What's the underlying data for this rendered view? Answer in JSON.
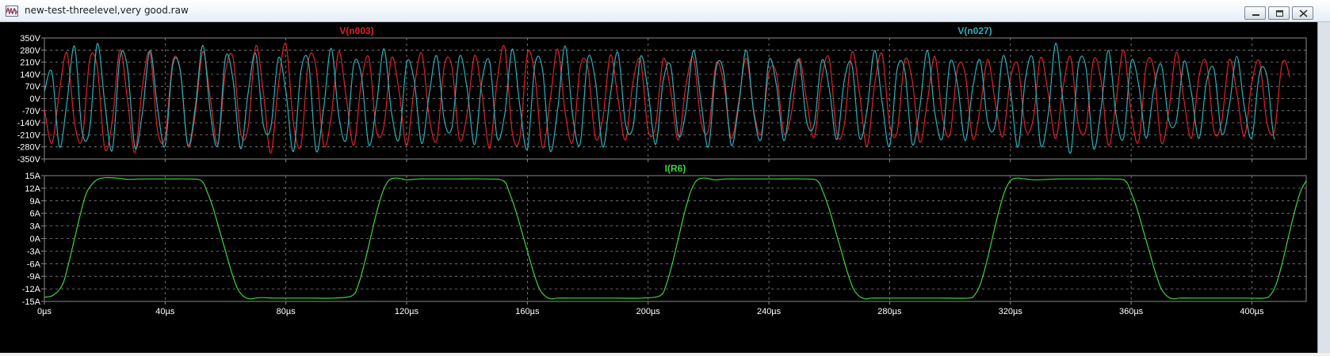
{
  "window": {
    "title": "new-test-threelevel,very good.raw",
    "icon": "waveform-icon",
    "buttons": [
      "minimize-icon",
      "restore-icon",
      "close-icon"
    ]
  },
  "colors": {
    "background": "#000000",
    "grid": "#8a8a8a",
    "axis_text": "#ffffff",
    "v_n003": "#e0222a",
    "v_n027": "#2bb0b8",
    "i_r6": "#3fd23f"
  },
  "chart_data": [
    {
      "type": "line",
      "title": "",
      "xlabel": "",
      "ylabel": "",
      "xlim": [
        0,
        418
      ],
      "ylim": [
        -350,
        350
      ],
      "x_ticks": [
        "0µs",
        "40µs",
        "80µs",
        "120µs",
        "160µs",
        "200µs",
        "240µs",
        "280µs",
        "320µs",
        "360µs",
        "400µs"
      ],
      "y_ticks": [
        "350V",
        "280V",
        "210V",
        "140V",
        "70V",
        "0V",
        "-70V",
        "-140V",
        "-210V",
        "-280V",
        "-350V"
      ],
      "grid": true,
      "series": [
        {
          "name": "V(n003)",
          "color": "#e0222a",
          "description_values": {
            "x": [
              0,
              2.5,
              5,
              7.5,
              10,
              12.5,
              15,
              17.5,
              20,
              22.5,
              25,
              27.5,
              30,
              32.5,
              35,
              37.5,
              40,
              42.5,
              45,
              47.5,
              50,
              52.5,
              55,
              57.5,
              60,
              62.5,
              65,
              67.5,
              70,
              72.5,
              75,
              77.5,
              80,
              82.5,
              85,
              87.5,
              90,
              92.5,
              95,
              97.5,
              100,
              102.5,
              105,
              107.5,
              110,
              112.5,
              115,
              117.5,
              120,
              122.5,
              125,
              127.5,
              130,
              132.5,
              135,
              137.5,
              140,
              142.5,
              145,
              147.5,
              150,
              152.5,
              155,
              157.5,
              160,
              162.5,
              165,
              167.5,
              170,
              172.5,
              175,
              177.5,
              180,
              182.5,
              185,
              187.5,
              190,
              192.5,
              195,
              197.5,
              200,
              202.5,
              205,
              207.5,
              210,
              212.5,
              215,
              217.5,
              220,
              222.5,
              225,
              227.5,
              230,
              232.5,
              235,
              237.5,
              240,
              242.5,
              245,
              247.5,
              250,
              252.5,
              255,
              257.5,
              260,
              262.5,
              265,
              267.5,
              270,
              272.5,
              275,
              277.5,
              280,
              282.5,
              285,
              287.5,
              290,
              292.5,
              295,
              297.5,
              300,
              302.5,
              305,
              307.5,
              310,
              312.5,
              315,
              317.5,
              320,
              322.5,
              325,
              327.5,
              330,
              332.5,
              335,
              337.5,
              340,
              342.5,
              345,
              347.5,
              350,
              352.5,
              355,
              357.5,
              360,
              362.5,
              365,
              367.5,
              370,
              372.5,
              375,
              377.5,
              380,
              382.5,
              385,
              387.5,
              390,
              392.5,
              395,
              397.5,
              400,
              402.5,
              405,
              407.5,
              410,
              412.5,
              415,
              417.5
            ],
            "y": [
              -60,
              -259,
              42,
              264,
              -142,
              -236,
              223,
              182,
              -290,
              -129,
              280,
              -3,
              -312,
              73,
              263,
              -185,
              -221,
              212,
              160,
              -275,
              -89,
              271,
              -3,
              -261,
              158,
              236,
              -199,
              -166,
              303,
              42,
              -315,
              76,
              316,
              -141,
              -270,
              223,
              179,
              -270,
              -108,
              271,
              5,
              -270,
              96,
              235,
              -189,
              -156,
              236,
              42,
              -273,
              62,
              261,
              -109,
              -240,
              191,
              183,
              -235,
              -93,
              249,
              22,
              -288,
              105,
              296,
              -196,
              -226,
              260,
              132,
              -284,
              -20,
              287,
              -80,
              -251,
              181,
              183,
              -225,
              -114,
              251,
              4,
              -240,
              98,
              220,
              -185,
              -154,
              229,
              39,
              -240,
              74,
              236,
              -131,
              -179,
              199,
              90,
              -229,
              -21,
              234,
              -73,
              -203,
              150,
              144,
              -201,
              -80,
              232,
              -10,
              -225,
              118,
              232,
              -202,
              -150,
              269,
              33,
              -277,
              77,
              257,
              -150,
              -193,
              221,
              102,
              -253,
              -16,
              243,
              -106,
              -208,
              175,
              146,
              -231,
              -56,
              226,
              -25,
              -220,
              114,
              194,
              -176,
              -124,
              237,
              33,
              -231,
              70,
              239,
              -145,
              -177,
              222,
              110,
              -272,
              -15,
              281,
              -83,
              -250,
              192,
              171,
              -255,
              -70,
              268,
              -10,
              -228,
              131,
              204,
              -193,
              -131,
              224,
              35,
              -220,
              94,
              213,
              -141,
              -185,
              201,
              123,
              -208
            ]
          }
        },
        {
          "name": "V(n027)",
          "color": "#2bb0b8",
          "description_values": {
            "x": [
              0,
              2.5,
              5,
              7.5,
              10,
              12.5,
              15,
              17.5,
              20,
              22.5,
              25,
              27.5,
              30,
              32.5,
              35,
              37.5,
              40,
              42.5,
              45,
              47.5,
              50,
              52.5,
              55,
              57.5,
              60,
              62.5,
              65,
              67.5,
              70,
              72.5,
              75,
              77.5,
              80,
              82.5,
              85,
              87.5,
              90,
              92.5,
              95,
              97.5,
              100,
              102.5,
              105,
              107.5,
              110,
              112.5,
              115,
              117.5,
              120,
              122.5,
              125,
              127.5,
              130,
              132.5,
              135,
              137.5,
              140,
              142.5,
              145,
              147.5,
              150,
              152.5,
              155,
              157.5,
              160,
              162.5,
              165,
              167.5,
              170,
              172.5,
              175,
              177.5,
              180,
              182.5,
              185,
              187.5,
              190,
              192.5,
              195,
              197.5,
              200,
              202.5,
              205,
              207.5,
              210,
              212.5,
              215,
              217.5,
              220,
              222.5,
              225,
              227.5,
              230,
              232.5,
              235,
              237.5,
              240,
              242.5,
              245,
              247.5,
              250,
              252.5,
              255,
              257.5,
              260,
              262.5,
              265,
              267.5,
              270,
              272.5,
              275,
              277.5,
              280,
              282.5,
              285,
              287.5,
              290,
              292.5,
              295,
              297.5,
              300,
              302.5,
              305,
              307.5,
              310,
              312.5,
              315,
              317.5,
              320,
              322.5,
              325,
              327.5,
              330,
              332.5,
              335,
              337.5,
              340,
              342.5,
              345,
              347.5,
              350,
              352.5,
              355,
              357.5,
              360,
              362.5,
              365,
              367.5,
              370,
              372.5,
              375,
              377.5,
              380,
              382.5,
              385,
              387.5,
              390,
              392.5,
              395,
              397.5,
              400,
              402.5,
              405,
              407.5,
              410,
              412.5,
              415,
              417.5
            ],
            "y": [
              40,
              153,
              -280,
              -16,
              302,
              -193,
              -178,
              317,
              -25,
              -299,
              232,
              181,
              -285,
              -77,
              278,
              -56,
              -274,
              194,
              163,
              -268,
              -50,
              307,
              -85,
              -267,
              239,
              108,
              -290,
              34,
              260,
              -149,
              -169,
              234,
              42,
              -306,
              158,
              209,
              -303,
              -59,
              290,
              -98,
              -235,
              199,
              133,
              -270,
              -39,
              287,
              -81,
              -234,
              205,
              103,
              -260,
              27,
              246,
              -128,
              -166,
              243,
              61,
              -267,
              109,
              212,
              -228,
              -90,
              286,
              -41,
              -292,
              196,
              171,
              -302,
              -67,
              304,
              -101,
              -261,
              232,
              106,
              -281,
              22,
              267,
              -147,
              -164,
              243,
              41,
              -265,
              102,
              187,
              -212,
              -74,
              278,
              -16,
              -279,
              173,
              155,
              -269,
              -41,
              281,
              -85,
              -231,
              219,
              77,
              -244,
              50,
              222,
              -133,
              -150,
              219,
              58,
              -238,
              108,
              196,
              -227,
              -70,
              278,
              -22,
              -276,
              169,
              162,
              -265,
              -49,
              278,
              -84,
              -227,
              208,
              80,
              -244,
              57,
              220,
              -141,
              -152,
              244,
              51,
              -282,
              117,
              226,
              -267,
              -95,
              319,
              -26,
              -314,
              188,
              181,
              -287,
              -62,
              279,
              -96,
              -228,
              213,
              80,
              -229,
              53,
              196,
              -130,
              -126,
              214,
              29,
              -231,
              99,
              165,
              -204,
              -44,
              244,
              -48,
              -226,
              146,
              129,
              -237,
              -22
            ]
          }
        }
      ]
    },
    {
      "type": "line",
      "title": "",
      "xlabel": "",
      "ylabel": "",
      "xlim": [
        0,
        418
      ],
      "ylim": [
        -15,
        15
      ],
      "x_ticks": [
        "0µs",
        "40µs",
        "80µs",
        "120µs",
        "160µs",
        "200µs",
        "240µs",
        "280µs",
        "320µs",
        "360µs",
        "400µs"
      ],
      "y_ticks": [
        "15A",
        "12A",
        "9A",
        "6A",
        "3A",
        "0A",
        "-3A",
        "-6A",
        "-9A",
        "-12A",
        "-15A"
      ],
      "grid": true,
      "series": [
        {
          "name": "I(R6)",
          "color": "#3fd23f",
          "description_values": {
            "x": [
              0,
              3,
              6,
              8,
              10,
              12,
              14,
              17,
              20,
              24,
              28,
              32,
              40,
              48,
              52,
              54,
              56,
              58,
              60,
              62,
              64,
              66,
              68,
              70,
              72,
              76,
              80,
              88,
              96,
              102,
              104,
              106,
              108,
              110,
              112,
              114,
              116,
              118,
              120,
              124,
              128,
              136,
              146,
              152,
              154,
              156,
              158,
              160,
              162,
              164,
              166,
              168,
              170,
              174,
              180,
              188,
              198,
              204,
              206,
              208,
              210,
              212,
              214,
              216,
              218,
              220,
              222,
              226,
              232,
              242,
              252,
              256,
              258,
              260,
              262,
              264,
              266,
              268,
              270,
              272,
              274,
              278,
              286,
              296,
              306,
              308,
              310,
              312,
              314,
              316,
              318,
              320,
              322,
              324,
              328,
              336,
              346,
              354,
              358,
              360,
              362,
              364,
              366,
              368,
              370,
              372,
              374,
              376,
              380,
              388,
              398,
              404,
              406,
              408,
              410,
              412,
              414,
              416,
              418
            ],
            "y": [
              -14,
              -13.5,
              -11,
              -6,
              0,
              6,
              11,
              13.8,
              14.5,
              14.4,
              14.1,
              14.2,
              14.2,
              14.2,
              13.8,
              11,
              7,
              2,
              -3,
              -8,
              -12,
              -13.8,
              -14.4,
              -14.2,
              -14.1,
              -14.2,
              -14.2,
              -14.2,
              -14.2,
              -13.6,
              -11,
              -6,
              0,
              6,
              11,
              13.8,
              14.4,
              14.3,
              14,
              14.2,
              14.2,
              14.2,
              14.2,
              13.8,
              11,
              7,
              2,
              -3,
              -8,
              -12,
              -13.8,
              -14.4,
              -14.2,
              -14.2,
              -14.2,
              -14.2,
              -14.2,
              -13.6,
              -11,
              -6,
              0,
              6,
              11,
              13.8,
              14.4,
              14.3,
              14,
              14.2,
              14.2,
              14.2,
              14.2,
              13.8,
              11,
              7,
              2,
              -3,
              -8,
              -12,
              -13.8,
              -14.4,
              -14.2,
              -14.2,
              -14.2,
              -14.2,
              -14.2,
              -13.6,
              -11,
              -6,
              0,
              6,
              11,
              13.8,
              14.4,
              14.3,
              14,
              14.2,
              14.2,
              14.2,
              13.8,
              11,
              7,
              2,
              -3,
              -8,
              -12,
              -13.8,
              -14.4,
              -14.2,
              -14.2,
              -14.2,
              -14.2,
              -14.2,
              -13.6,
              -11,
              -6,
              0,
              6,
              11,
              13.8
            ]
          }
        }
      ]
    }
  ]
}
